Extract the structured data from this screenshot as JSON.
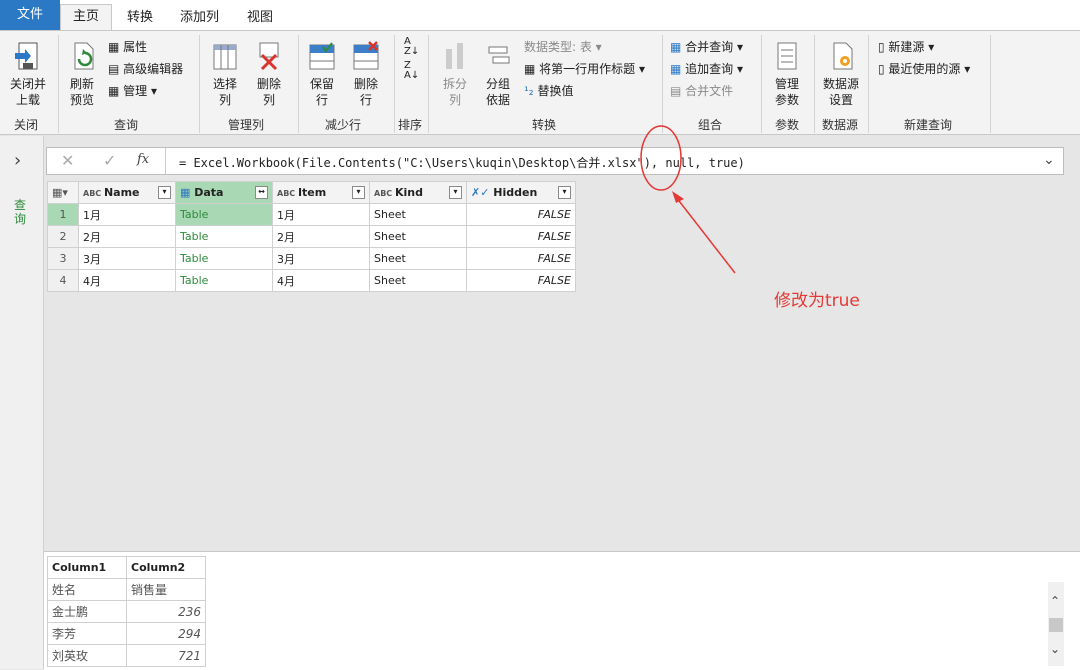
{
  "menu": {
    "file": "文件",
    "tabs": [
      "主页",
      "转换",
      "添加列",
      "视图"
    ]
  },
  "ribbon": {
    "close": {
      "btn": "关闭并\n上载",
      "group": "关闭"
    },
    "query": {
      "refresh": "刷新\n预览",
      "properties": "属性",
      "advanced_editor": "高级编辑器",
      "manage": "管理",
      "group": "查询"
    },
    "manage_columns": {
      "choose": "选择\n列",
      "remove": "删除\n列",
      "group": "管理列"
    },
    "reduce_rows": {
      "keep": "保留\n行",
      "remove": "删除\n行",
      "group": "减少行"
    },
    "sort": {
      "group": "排序"
    },
    "transform": {
      "split": "拆分\n列",
      "group_by": "分组\n依据",
      "data_type": "数据类型: 表",
      "first_row_header": "将第一行用作标题",
      "replace": "替换值",
      "group": "转换"
    },
    "combine": {
      "merge": "合并查询",
      "append": "追加查询",
      "combine_files": "合并文件",
      "group": "组合"
    },
    "params": {
      "manage": "管理\n参数",
      "group": "参数"
    },
    "datasource": {
      "settings": "数据源\n设置",
      "group": "数据源"
    },
    "new_query": {
      "new_source": "新建源",
      "recent": "最近使用的源",
      "group": "新建查询"
    }
  },
  "nav": {
    "label": "查询",
    "expand": "›"
  },
  "formula_bar": {
    "cancel": "✕",
    "confirm": "✓",
    "fx": "fx",
    "formula": "= Excel.Workbook(File.Contents(\"C:\\Users\\kuqin\\Desktop\\合并.xlsx\"), null, true)"
  },
  "annotation": {
    "text": "修改为true",
    "color": "#e53935"
  },
  "grid": {
    "headers": [
      {
        "type": "ABC",
        "name": "Name"
      },
      {
        "type": "table",
        "name": "Data"
      },
      {
        "type": "ABC",
        "name": "Item"
      },
      {
        "type": "ABC",
        "name": "Kind"
      },
      {
        "type": "bool",
        "name": "Hidden"
      }
    ],
    "rows": [
      {
        "num": "1",
        "name": "1月",
        "data": "Table",
        "item": "1月",
        "kind": "Sheet",
        "hidden": "FALSE"
      },
      {
        "num": "2",
        "name": "2月",
        "data": "Table",
        "item": "2月",
        "kind": "Sheet",
        "hidden": "FALSE"
      },
      {
        "num": "3",
        "name": "3月",
        "data": "Table",
        "item": "3月",
        "kind": "Sheet",
        "hidden": "FALSE"
      },
      {
        "num": "4",
        "name": "4月",
        "data": "Table",
        "item": "4月",
        "kind": "Sheet",
        "hidden": "FALSE"
      }
    ]
  },
  "preview": {
    "headers": [
      "Column1",
      "Column2"
    ],
    "rows": [
      [
        "姓名",
        "销售量"
      ],
      [
        "金士鹏",
        "236"
      ],
      [
        "李芳",
        "294"
      ],
      [
        "刘英玫",
        "721"
      ]
    ]
  },
  "colors": {
    "file_tab": "#2b78c5",
    "selected_cell": "#a8d8b4",
    "table_link": "#2e8b3a"
  }
}
